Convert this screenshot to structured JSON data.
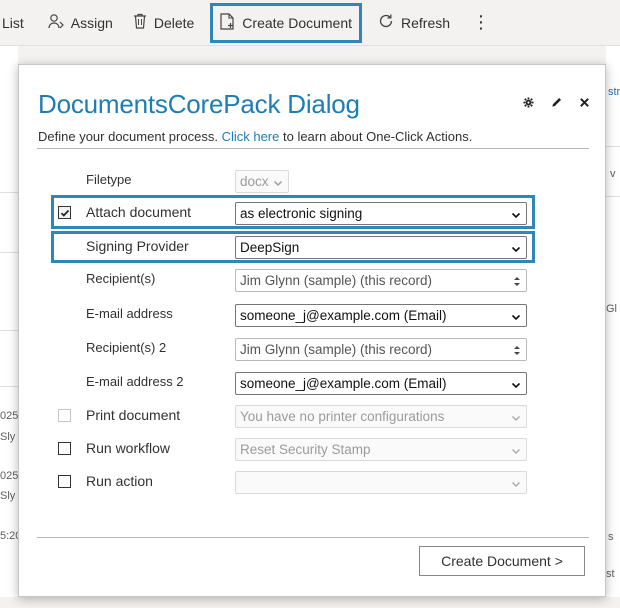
{
  "toolbar": {
    "list_label": "List",
    "assign_label": "Assign",
    "delete_label": "Delete",
    "create_document_label": "Create Document",
    "refresh_label": "Refresh",
    "more_label": "⋮"
  },
  "background": {
    "right_fragment_1": "str",
    "right_fragment_2": "v",
    "right_fragment_3": "Gl",
    "right_fragment_4": "s",
    "right_fragment_5": "st",
    "left_fragment_1": "025",
    "left_fragment_2": "Sly",
    "left_fragment_3": "025,",
    "left_fragment_4": "Sly",
    "left_fragment_5": "5:20"
  },
  "dialog": {
    "title": "DocumentsCorePack Dialog",
    "subtitle_prefix": "Define your document process.",
    "subtitle_link": "Click here",
    "subtitle_suffix": "to learn about One-Click Actions.",
    "filetype": {
      "label": "Filetype",
      "value": "docx"
    },
    "attach_document": {
      "label": "Attach document",
      "checked": true,
      "value": "as electronic signing"
    },
    "signing_provider": {
      "label": "Signing Provider",
      "value": "DeepSign"
    },
    "recipients": {
      "label": "Recipient(s)",
      "value": "Jim Glynn (sample) (this record)"
    },
    "email_address": {
      "label": "E-mail address",
      "value": "someone_j@example.com (Email)"
    },
    "recipients_2": {
      "label": "Recipient(s) 2",
      "value": "Jim Glynn (sample) (this record)"
    },
    "email_address_2": {
      "label": "E-mail address 2",
      "value": "someone_j@example.com (Email)"
    },
    "print_document": {
      "label": "Print document",
      "checked": false,
      "value": "You have no printer configurations"
    },
    "run_workflow": {
      "label": "Run workflow",
      "checked": false,
      "value": "Reset Security Stamp"
    },
    "run_action": {
      "label": "Run action",
      "checked": false,
      "value": ""
    },
    "create_button_label": "Create Document >"
  },
  "colors": {
    "accent": "#1f7db3",
    "highlight": "#2f86b8"
  }
}
